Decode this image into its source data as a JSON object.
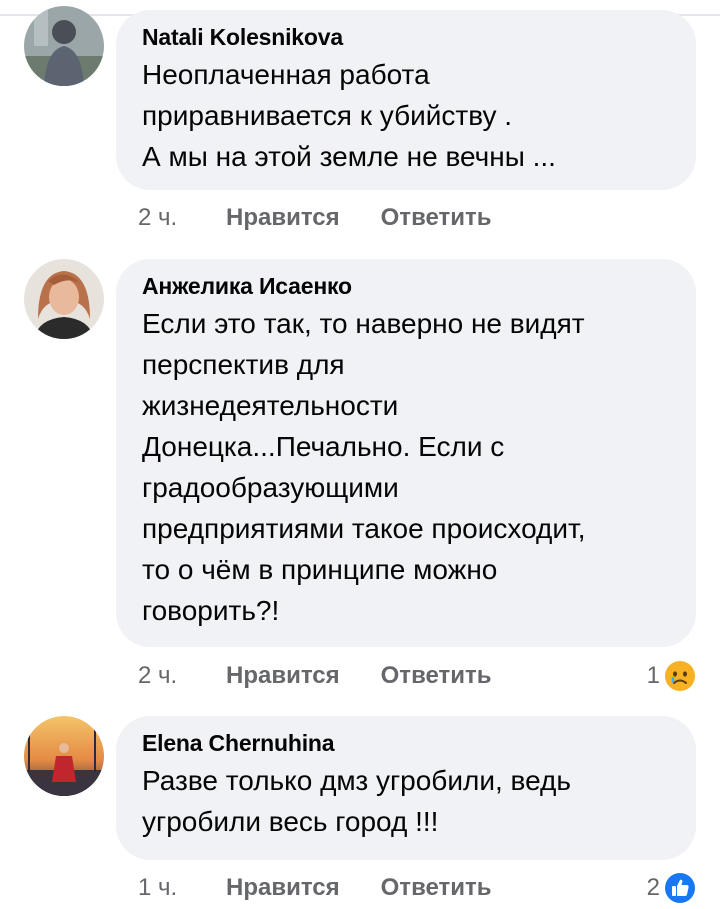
{
  "comments": [
    {
      "author": "Natali Kolesnikova",
      "text": "Неоплаченная  работа\nприравнивается к убийству .\nА мы на этой земле не вечны ...",
      "time": "2 ч.",
      "like_label": "Нравится",
      "reply_label": "Ответить",
      "reaction_count": "",
      "reaction_icon": ""
    },
    {
      "author": "Анжелика Исаенко",
      "text": "Если это так, то наверно не видят\nперспектив для\nжизнедеятельности\nДонецка...Печально. Если с\nградообразующими\nпредприятиями такое происходит,\nто о чём в принципе можно\nговорить?!",
      "time": "2 ч.",
      "like_label": "Нравится",
      "reply_label": "Ответить",
      "reaction_count": "1",
      "reaction_icon": "sad-face-icon",
      "reaction_color": "#f7b125"
    },
    {
      "author": "Elena Chernuhina",
      "text": "Разве только дмз угробили, ведь\nугробили весь город !!!",
      "time": "1 ч.",
      "like_label": "Нравится",
      "reply_label": "Ответить",
      "reaction_count": "2",
      "reaction_icon": "thumbs-up-icon",
      "reaction_color": "#1877f2"
    }
  ]
}
